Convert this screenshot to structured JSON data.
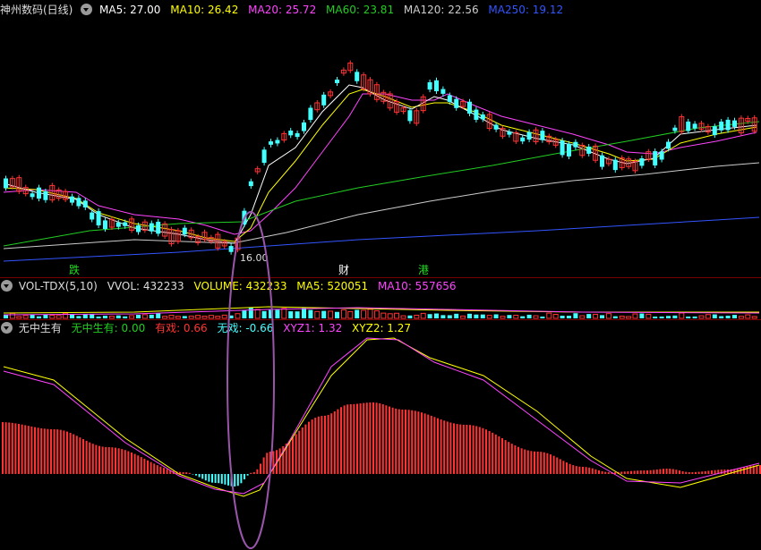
{
  "main": {
    "title": "神州数码(日线)",
    "ma_legend": [
      {
        "label": "MA5: 27.00",
        "color": "#ffffff"
      },
      {
        "label": "MA10: 26.42",
        "color": "#ffff00"
      },
      {
        "label": "MA20: 25.72",
        "color": "#ff44ff"
      },
      {
        "label": "MA60: 23.81",
        "color": "#22cc22"
      },
      {
        "label": "MA120: 22.56",
        "color": "#cccccc"
      },
      {
        "label": "MA250: 19.12",
        "color": "#3355ff"
      }
    ],
    "low_price_label": "16.00",
    "events": [
      {
        "text": "跌",
        "color": "#22dd22"
      },
      {
        "text": "财",
        "color": "#ffffff"
      },
      {
        "text": "港",
        "color": "#22dd22"
      }
    ]
  },
  "volume": {
    "legend": [
      {
        "label": "VOL-TDX(5,10)",
        "color": "#dddddd"
      },
      {
        "label": "VVOL: 432233",
        "color": "#dddddd"
      },
      {
        "label": "VOLUME: 432233",
        "color": "#ffff00"
      },
      {
        "label": "MA5: 520051",
        "color": "#ffff00"
      },
      {
        "label": "MA10: 557656",
        "color": "#ff44ff"
      }
    ]
  },
  "indicator": {
    "legend": [
      {
        "label": "无中生有",
        "color": "#dddddd"
      },
      {
        "label": "无中生有: 0.00",
        "color": "#22cc22"
      },
      {
        "label": "有戏: 0.66",
        "color": "#ff3333"
      },
      {
        "label": "无戏: -0.66",
        "color": "#44ffff"
      },
      {
        "label": "XYZ1: 1.32",
        "color": "#ff44ff"
      },
      {
        "label": "XYZ2: 1.27",
        "color": "#ffff00"
      }
    ]
  },
  "colors": {
    "up": "#ff3333",
    "down": "#44ffff",
    "ma5": "#ffffff",
    "ma10": "#ffff00",
    "ma20": "#ff44ff",
    "ma60": "#22cc22",
    "ma120": "#cccccc",
    "ma250": "#3355ff",
    "ellipse": "#9955aa"
  },
  "icons": {
    "collapse": "triangle-down-icon"
  }
}
